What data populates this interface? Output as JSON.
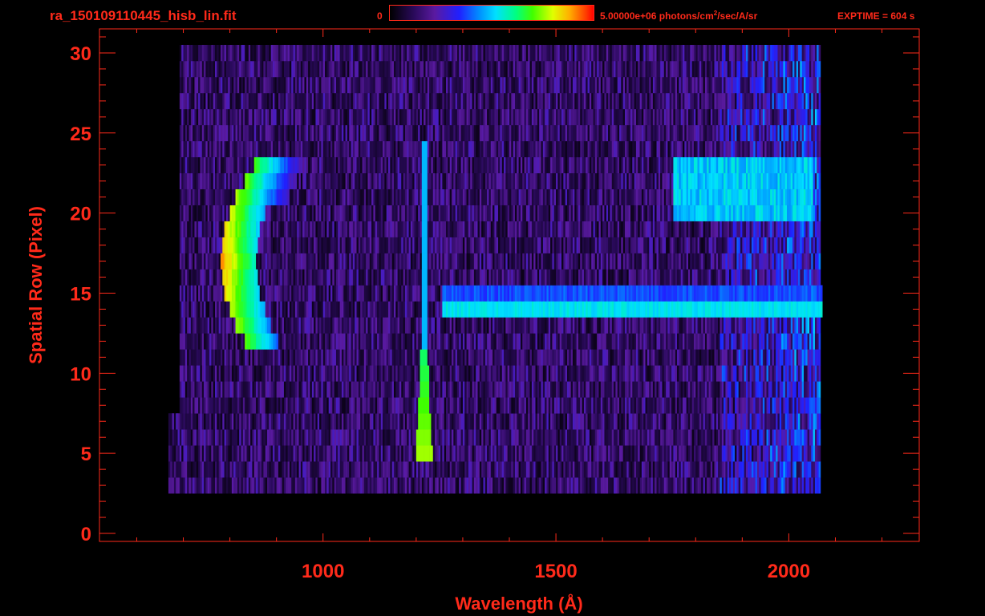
{
  "header": {
    "filename": "ra_150109110445_hisb_lin.fit",
    "colorbar_min": "0",
    "colorbar_max_prefix": "5.00000e+06 photons/cm",
    "colorbar_max_exp": "2",
    "colorbar_max_suffix": "/sec/A/sr",
    "exptime": "EXPTIME = 604 s"
  },
  "colors": {
    "axis": "#ff2a1a",
    "background": "#000000"
  },
  "chart_data": {
    "type": "heatmap",
    "title": "ra_150109110445_hisb_lin.fit",
    "xlabel": "Wavelength (Å)",
    "ylabel": "Spatial Row (Pixel)",
    "xlim": [
      520,
      2280
    ],
    "ylim": [
      -0.5,
      31.5
    ],
    "xticks": [
      1000,
      1500,
      2000
    ],
    "xtick_labels": [
      "1000",
      "1500",
      "2000"
    ],
    "yticks": [
      0,
      5,
      10,
      15,
      20,
      25,
      30
    ],
    "ytick_labels": [
      "0",
      "5",
      "10",
      "15",
      "20",
      "25",
      "30"
    ],
    "colorbar": {
      "min": 0,
      "max": 5000000,
      "units": "photons/cm²/sec/A/sr",
      "colormap": "rainbow"
    },
    "exptime_s": 604,
    "features": [
      {
        "name": "arc emission",
        "wavelength_range": [
          780,
          935
        ],
        "rows": [
          12,
          23
        ]
      },
      {
        "name": "vertical line",
        "wavelength": 1215,
        "rows": [
          5,
          24
        ]
      },
      {
        "name": "horizontal band",
        "wavelength_range": [
          1255,
          2070
        ],
        "row": 14.5
      },
      {
        "name": "upper band",
        "wavelength_range": [
          1750,
          2050
        ],
        "rows": [
          20,
          23
        ]
      }
    ]
  }
}
